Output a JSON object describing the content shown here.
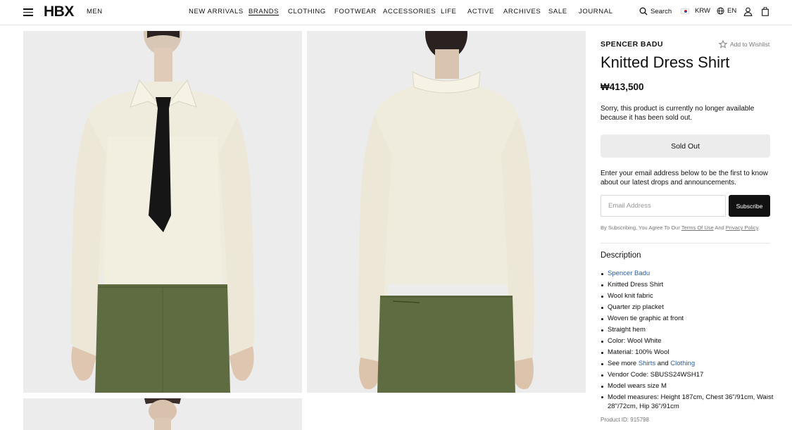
{
  "header": {
    "logo": "HBX",
    "section": "MEN",
    "nav": [
      "NEW ARRIVALS",
      "BRANDS",
      "CLOTHING",
      "FOOTWEAR",
      "ACCESSORIES",
      "LIFE",
      "ACTIVE",
      "ARCHIVES",
      "SALE",
      "JOURNAL"
    ],
    "active_nav": "BRANDS",
    "search_label": "Search",
    "currency": "KRW",
    "language": "EN",
    "icons": [
      "menu-icon",
      "search-icon",
      "korea-flag-icon",
      "globe-icon",
      "user-icon",
      "bag-icon"
    ]
  },
  "gallery": {
    "images": [
      "front-view",
      "back-view",
      "detail-view"
    ]
  },
  "product": {
    "brand": "SPENCER BADU",
    "wishlist_label": "Add to Wishlist",
    "title": "Knitted Dress Shirt",
    "price": "₩413,500",
    "sold_out_message": "Sorry, this product is currently no longer available because it has been sold out.",
    "sold_out_button": "Sold Out",
    "notify_text": "Enter your email address below to be the first to know about our latest drops and announcements.",
    "email_placeholder": "Email Address",
    "subscribe_label": "Subscribe",
    "agree_prefix": "By Subscribing, You Agree To Our",
    "terms_label": "Terms Of Use",
    "agree_and": "And",
    "privacy_label": "Privacy Policy",
    "agree_suffix": ".",
    "description_heading": "Description",
    "description": {
      "brand_link": "Spencer Badu",
      "name": "Knitted Dress Shirt",
      "fabric": "Wool knit fabric",
      "placket": "Quarter zip placket",
      "graphic": "Woven tie graphic at front",
      "hem": "Straight hem",
      "color": "Color: Wool White",
      "material": "Material: 100% Wool",
      "see_more_prefix": "See more",
      "see_more_link1": "Shirts",
      "see_more_and": "and",
      "see_more_link2": "Clothing",
      "vendor_code": "Vendor Code: SBUSS24WSH17",
      "model_size": "Model wears size M",
      "model_measures": "Model measures: Height 187cm, Chest 36\"/91cm, Waist 28\"/72cm, Hip 36\"/91cm"
    },
    "product_id": "Product ID: 915798"
  },
  "colors": {
    "link": "#2c5fa8",
    "image_bg": "#ececec",
    "knit": "#f0ecdd",
    "tie": "#141414",
    "pants": "#5f6b40"
  }
}
